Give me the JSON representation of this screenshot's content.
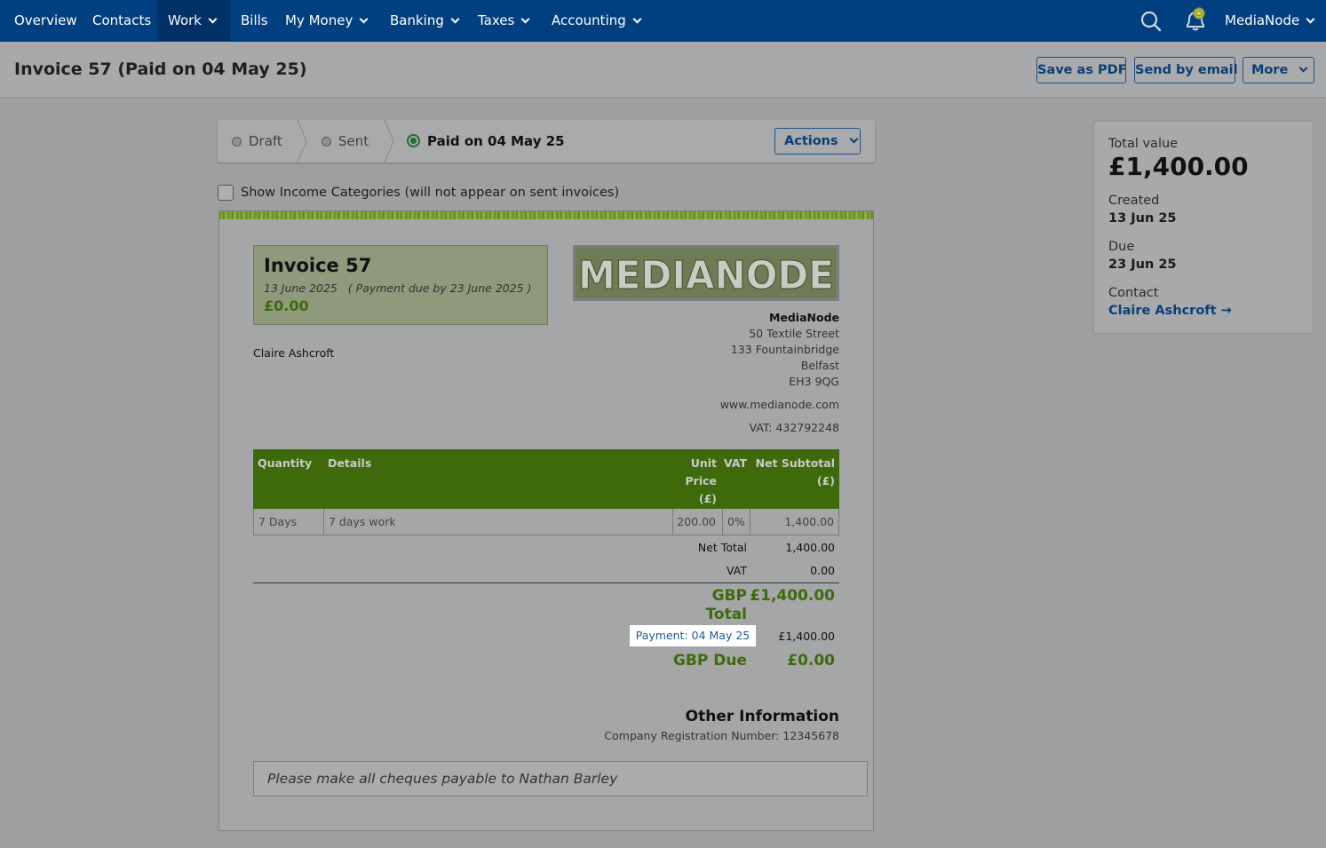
{
  "nav": {
    "items": [
      {
        "label": "Overview"
      },
      {
        "label": "Contacts"
      },
      {
        "label": "Work"
      },
      {
        "label": "Bills"
      },
      {
        "label": "My Money"
      },
      {
        "label": "Banking"
      },
      {
        "label": "Taxes"
      },
      {
        "label": "Accounting"
      }
    ],
    "active": "Work",
    "account_label": "MediaNode",
    "search_icon": "search-icon",
    "bell_icon": "bell-icon"
  },
  "header": {
    "title": "Invoice 57 (Paid on 04 May 25)",
    "save_pdf": "Save as PDF",
    "send_email": "Send by email",
    "more": "More"
  },
  "status": {
    "steps": [
      "Draft",
      "Sent",
      "Paid on 04 May 25"
    ],
    "current": "Paid on 04 May 25",
    "actions": "Actions"
  },
  "show_categories": {
    "label": "Show Income Categories (will not appear on sent invoices)",
    "checked": false
  },
  "invoice": {
    "title": "Invoice 57",
    "date_line": "13 June 2025   ( Payment due by 23 June 2025 )",
    "amount_due": "£0.00",
    "client_name": "Claire Ashcroft",
    "logo_text": "MEDIANODE",
    "company": {
      "name": "MediaNode",
      "address": [
        "50 Textile Street",
        "133 Fountainbridge",
        "Belfast",
        "EH3 9QG"
      ],
      "website": "www.medianode.com",
      "vat": "VAT: 432792248"
    },
    "table": {
      "headers": {
        "quantity": "Quantity",
        "details": "Details",
        "unit_price": [
          "Unit",
          "Price",
          "(£)"
        ],
        "vat": "VAT",
        "net_subtotal": [
          "Net Subtotal",
          "(£)"
        ]
      },
      "rows": [
        {
          "quantity": "7 Days",
          "details": "7 days work",
          "unit_price": "200.00",
          "vat": "0%",
          "net_subtotal": "1,400.00"
        }
      ]
    },
    "totals": {
      "net_total_label": "Net Total",
      "net_total": "1,400.00",
      "vat_label": "VAT",
      "vat": "0.00",
      "gbp_total_label": [
        "GBP",
        "Total"
      ],
      "gbp_total": "£1,400.00",
      "payment_label": "Payment: 04 May 25",
      "payment_amount": "£1,400.00",
      "gbp_due_label": "GBP Due",
      "gbp_due": "£0.00"
    },
    "other_info": {
      "title": "Other Information",
      "reg_number": "Company Registration Number: 12345678"
    },
    "notes": "Please make all cheques payable to Nathan Barley"
  },
  "summary": {
    "total_value_label": "Total value",
    "total_value": "£1,400.00",
    "created_label": "Created",
    "created": "13 Jun 25",
    "due_label": "Due",
    "due": "23 Jun 25",
    "contact_label": "Contact",
    "contact": "Claire Ashcroft →"
  },
  "colors": {
    "nav_bg": "#003f80",
    "accent_green": "#3e6a0c",
    "link_blue": "#0b3f77"
  }
}
